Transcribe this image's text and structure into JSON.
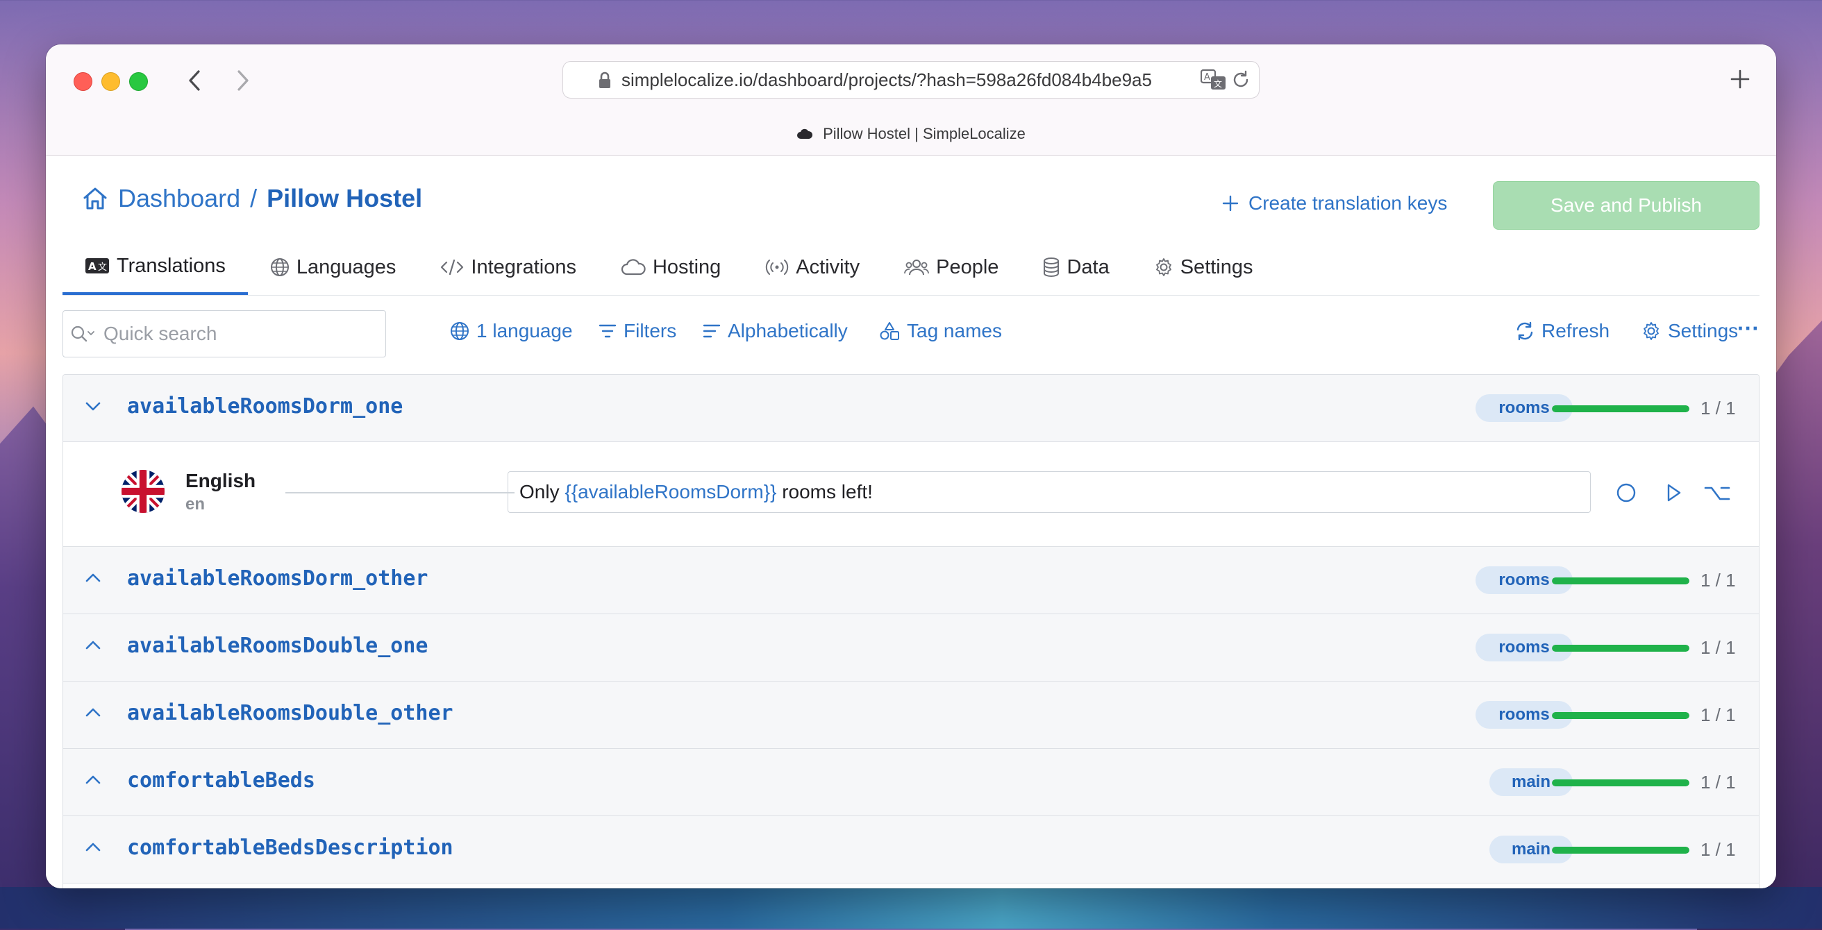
{
  "browser": {
    "url": "simplelocalize.io/dashboard/projects/?hash=598a26fd084b4be9a5",
    "tab_title": "Pillow Hostel | SimpleLocalize"
  },
  "header": {
    "breadcrumb_root": "Dashboard",
    "breadcrumb_sep": "/",
    "project_name": "Pillow Hostel",
    "create_keys_label": "Create translation keys",
    "save_label": "Save and Publish"
  },
  "tabs": [
    {
      "label": "Translations",
      "icon": "translations-icon",
      "active": true
    },
    {
      "label": "Languages",
      "icon": "globe-icon"
    },
    {
      "label": "Integrations",
      "icon": "code-icon"
    },
    {
      "label": "Hosting",
      "icon": "cloud-icon"
    },
    {
      "label": "Activity",
      "icon": "broadcast-icon"
    },
    {
      "label": "People",
      "icon": "people-icon"
    },
    {
      "label": "Data",
      "icon": "database-icon"
    },
    {
      "label": "Settings",
      "icon": "gear-icon"
    }
  ],
  "toolbar": {
    "search_placeholder": "Quick search",
    "languages_label": "1 language",
    "filters_label": "Filters",
    "sort_label": "Alphabetically",
    "tag_names_label": "Tag names",
    "refresh_label": "Refresh",
    "settings_label": "Settings",
    "more_label": "···"
  },
  "keys": [
    {
      "key": "availableRoomsDorm_one",
      "tag": "rooms",
      "progress": 1.0,
      "count": "1 / 1",
      "expanded": true
    },
    {
      "key": "availableRoomsDorm_other",
      "tag": "rooms",
      "progress": 1.0,
      "count": "1 / 1"
    },
    {
      "key": "availableRoomsDouble_one",
      "tag": "rooms",
      "progress": 1.0,
      "count": "1 / 1"
    },
    {
      "key": "availableRoomsDouble_other",
      "tag": "rooms",
      "progress": 1.0,
      "count": "1 / 1"
    },
    {
      "key": "comfortableBeds",
      "tag": "main",
      "progress": 1.0,
      "count": "1 / 1"
    },
    {
      "key": "comfortableBedsDescription",
      "tag": "main",
      "progress": 1.0,
      "count": "1 / 1"
    }
  ],
  "translation": {
    "language_name": "English",
    "language_code": "en",
    "text_before": "Only ",
    "text_var": "{{availableRoomsDorm}}",
    "text_after": " rooms left!"
  },
  "colors": {
    "accent": "#2f74c7",
    "progress": "#1fb24a",
    "save_disabled": "#a9ddb2"
  }
}
